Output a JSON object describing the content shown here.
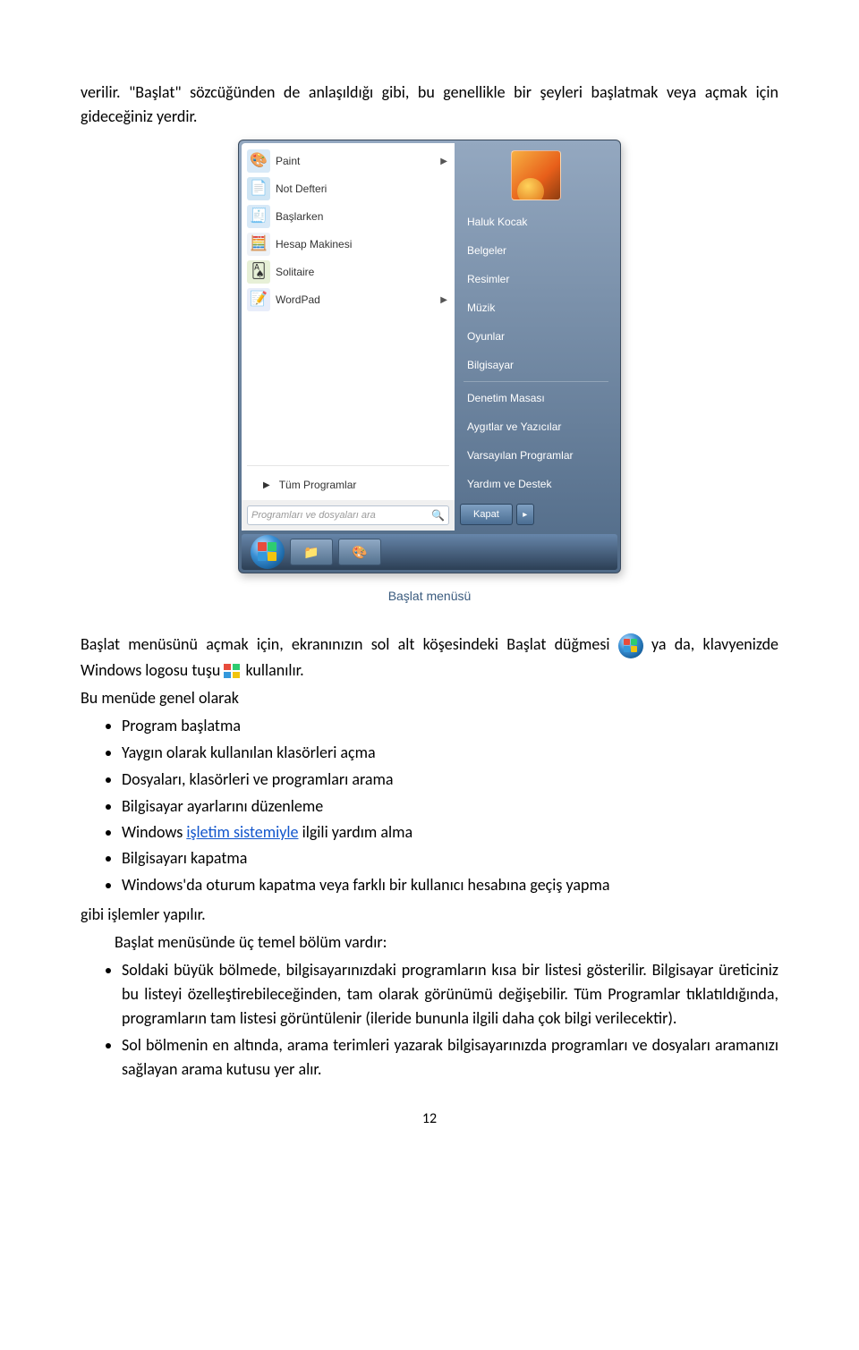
{
  "intro": "verilir. \"Başlat\" sözcüğünden de anlaşıldığı gibi, bu genellikle bir şeyleri başlatmak veya açmak için gideceğiniz yerdir.",
  "startmenu": {
    "left_programs": [
      {
        "label": "Paint",
        "has_sub": true,
        "icon": "🎨",
        "bg": "#d8e9f7"
      },
      {
        "label": "Not Defteri",
        "has_sub": false,
        "icon": "📄",
        "bg": "#cfe5f4"
      },
      {
        "label": "Başlarken",
        "has_sub": false,
        "icon": "🧾",
        "bg": "#d8e9f7"
      },
      {
        "label": "Hesap Makinesi",
        "has_sub": false,
        "icon": "🧮",
        "bg": "#eef2f7"
      },
      {
        "label": "Solitaire",
        "has_sub": false,
        "icon": "🂡",
        "bg": "#e7f0d7"
      },
      {
        "label": "WordPad",
        "has_sub": true,
        "icon": "📝",
        "bg": "#e8edfa"
      }
    ],
    "all_programs": "Tüm Programlar",
    "search_placeholder": "Programları ve dosyaları ara",
    "user_name": "Haluk Kocak",
    "right_items_top": [
      "Belgeler",
      "Resimler",
      "Müzik",
      "Oyunlar",
      "Bilgisayar"
    ],
    "right_items_bottom": [
      "Denetim Masası",
      "Aygıtlar ve Yazıcılar",
      "Varsayılan Programlar",
      "Yardım ve Destek"
    ],
    "shutdown": "Kapat"
  },
  "caption": "Başlat menüsü",
  "para2_a": "Başlat menüsünü açmak için, ekranınızın sol alt köşesindeki Başlat düğmesi ",
  "para2_b": " ya da, klavyenizde Windows logosu tuşu ",
  "para2_c": " kullanılır.",
  "para3": "Bu menüde genel olarak",
  "bullets1": [
    "Program başlatma",
    "Yaygın olarak kullanılan klasörleri açma",
    "Dosyaları, klasörleri ve programları arama",
    "Bilgisayar ayarlarını düzenleme"
  ],
  "bullet_win_a": "Windows ",
  "bullet_win_link": "işletim sistemiyle",
  "bullet_win_b": " ilgili yardım alma",
  "bullets2": [
    "Bilgisayarı kapatma",
    "Windows'da oturum kapatma veya farklı bir kullanıcı hesabına geçiş yapma"
  ],
  "after_list": "gibi işlemler yapılır.",
  "para4": "Başlat menüsünde üç temel bölüm vardır:",
  "bullets3": [
    "Soldaki büyük bölmede, bilgisayarınızdaki programların kısa bir listesi gösterilir. Bilgisayar üreticiniz bu listeyi özelleştirebileceğinden, tam olarak görünümü değişebilir. Tüm Programlar tıklatıldığında, programların tam listesi görüntülenir (ileride bununla ilgili daha çok bilgi verilecektir).",
    "Sol bölmenin en altında, arama terimleri yazarak bilgisayarınızda programları ve dosyaları aramanızı sağlayan arama kutusu yer alır."
  ],
  "pagenum": "12"
}
